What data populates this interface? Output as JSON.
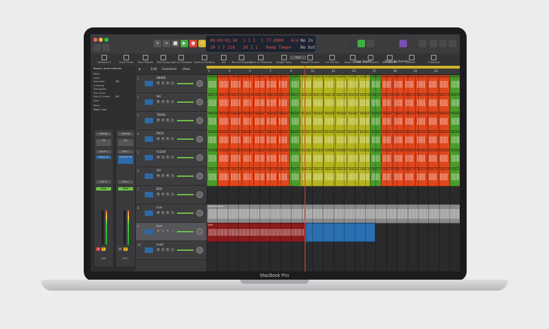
{
  "device": {
    "brand": "MacBook Pro"
  },
  "control_bar": {
    "window_buttons": [
      "close",
      "minimize",
      "zoom"
    ],
    "transport": [
      "rewind",
      "forward",
      "stop",
      "play",
      "record",
      "cycle"
    ],
    "lcd": {
      "time": "00:00:02.18",
      "bars_top": "1  1  1",
      "bars_bottom": "10  3  3  110",
      "position_bottom": "26  1  1",
      "bar": "1",
      "tempo": "77.0000",
      "tempo_label": "Keep Tempo",
      "signature": "4/4",
      "in_label": "No In",
      "out_label": "No Out"
    },
    "colors": {
      "play": "#3fae3f",
      "record": "#e0433a",
      "cycle": "#d6b62a"
    }
  },
  "toolbar": {
    "tools": [
      "Autopunch",
      "Track Zoom",
      "Bars Passed",
      "Beat Snap",
      "Split by Playhead",
      "Split by Locators",
      "Join",
      "Bounce Regions",
      "Move to Playhead",
      "Nudge Value",
      "Repeat Section",
      "Cut Section",
      "Insert Section",
      "Insert Silence",
      "Set Locators",
      "Zoom",
      "Crossfade"
    ],
    "nudge_value": "Tick"
  },
  "inspector": {
    "region_label": "Region: Audio Defaults",
    "rows": [
      {
        "label": "Mute:",
        "value": ""
      },
      {
        "label": "Loop:",
        "value": ""
      },
      {
        "label": "Quantize:",
        "value": "Off"
      },
      {
        "label": "Q-Swing:",
        "value": ""
      },
      {
        "label": "Transpose:",
        "value": ""
      },
      {
        "label": "Fine Tune:",
        "value": ""
      },
      {
        "label": "Flex & Follow:",
        "value": "Off"
      },
      {
        "label": "Gain:",
        "value": ""
      }
    ],
    "more_label": "More",
    "track_label": "Track: Live",
    "strips": [
      {
        "name": "Live",
        "setting": "Setting",
        "eq": "EQ",
        "input": "Input 1",
        "mode": "Audio Fx",
        "send": "Bus 3",
        "read": "Read",
        "output": "Stereo Out"
      },
      {
        "name": "Out 1",
        "setting": "Setting",
        "eq": "EQ",
        "input": "Bus 1",
        "mode": "Channel EQ",
        "send": "Bus 1",
        "read": "Read",
        "output": "Stereo Out"
      }
    ]
  },
  "tracks_header": {
    "edit": "Edit",
    "functions": "Functions",
    "view": "View"
  },
  "tracks": [
    {
      "num": "1",
      "name": "SNARE",
      "color": "#e1461c"
    },
    {
      "num": "2",
      "name": "HH",
      "color": "#e1461c"
    },
    {
      "num": "3",
      "name": "TRASH",
      "color": "#e1461c"
    },
    {
      "num": "4",
      "name": "RACK",
      "color": "#e1461c"
    },
    {
      "num": "5",
      "name": "FLOOR",
      "color": "#e1461c"
    },
    {
      "num": "6",
      "name": "OH",
      "color": "#e1461c"
    },
    {
      "num": "7",
      "name": "BGV",
      "color": "#333333"
    },
    {
      "num": "8",
      "name": "Live",
      "color": "#888888"
    },
    {
      "num": "9",
      "name": "Live",
      "color": "#9b1e1e"
    },
    {
      "num": "10",
      "name": "Lead",
      "color": "#333333"
    }
  ],
  "arrange": {
    "snap": "Snap: Smart",
    "drag": "Drag: No Overlap",
    "ruler_bars": [
      "1",
      "3",
      "5",
      "7",
      "9",
      "11",
      "13",
      "15",
      "17",
      "19",
      "21",
      "23"
    ],
    "region_colors": {
      "red": "#e1461c",
      "yellow": "#b5b41e",
      "green": "#4c9a2a",
      "live": "#8a8a8a",
      "darkred": "#8b1c1c",
      "blue": "#2a6fb0"
    },
    "drum_labels": [
      "SNARE#1.26",
      "HH#1.26",
      "TRASH#1.26",
      "RACK#1.26",
      "FLOOR#1.26",
      "OH#1.26"
    ],
    "comp_label": "Live: Comp A",
    "take_label": "Live"
  }
}
